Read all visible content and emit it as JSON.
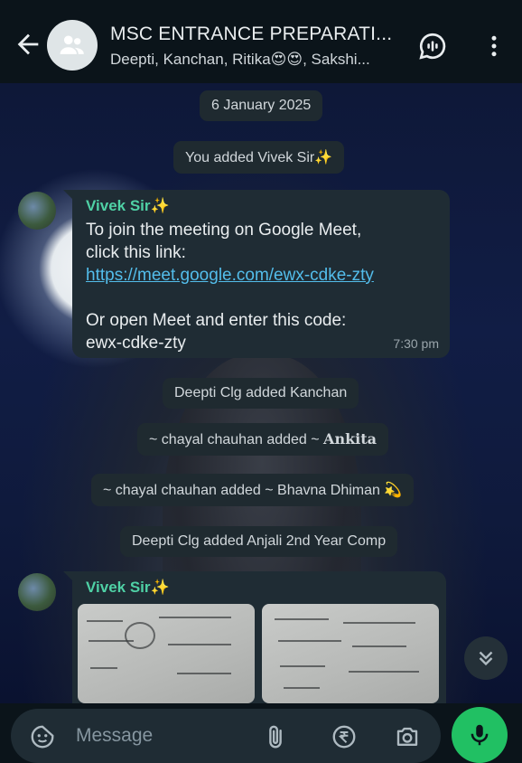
{
  "header": {
    "title": "MSC ENTRANCE PREPARATI...",
    "subtitle": "Deepti, Kanchan, Ritika😍😍, Sakshi..."
  },
  "chat": {
    "date_pill": "6 January 2025",
    "system_1": "You added Vivek Sir✨",
    "message_1": {
      "sender": "Vivek Sir✨",
      "line1": "To join the meeting on Google Meet,",
      "line2": "click this link:",
      "link": "https://meet.google.com/ewx-cdke-zty",
      "line3": "Or open Meet and enter this code:",
      "line4": "ewx-cdke-zty",
      "time": "7:30 pm"
    },
    "system_2": "Deepti Clg added Kanchan",
    "system_3_prefix": "~ chayal chauhan added ~ ",
    "system_3_name": "Ankita",
    "system_4": "~ chayal chauhan added ~ Bhavna Dhiman 💫",
    "system_5": "Deepti Clg added Anjali 2nd Year Comp",
    "message_2": {
      "sender": "Vivek Sir✨"
    }
  },
  "input": {
    "placeholder": "Message"
  },
  "colors": {
    "accent_green": "#21c063",
    "sender_color": "#4fd1a5",
    "link_color": "#53bdeb"
  }
}
